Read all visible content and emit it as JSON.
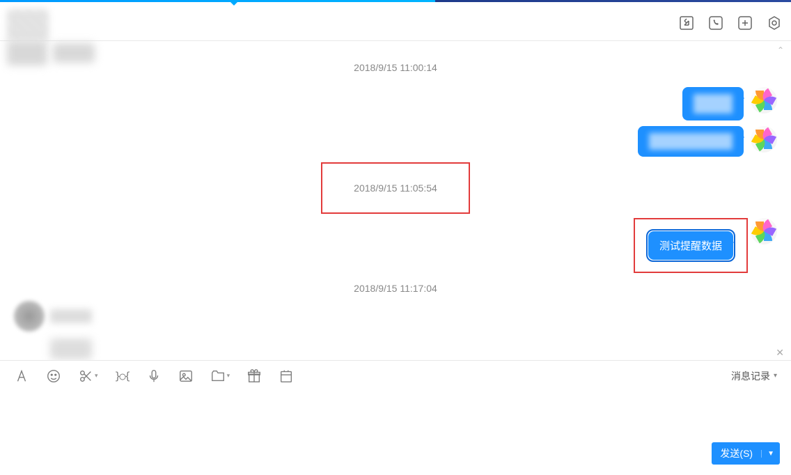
{
  "timestamps": {
    "t1": "2018/9/15 11:00:14",
    "t2": "2018/9/15 11:05:54",
    "t3": "2018/9/15 11:17:04"
  },
  "messages": {
    "test_reminder": "测试提醒数据"
  },
  "toolbar": {
    "history_label": "消息记录"
  },
  "send": {
    "label": "发送(S)"
  }
}
